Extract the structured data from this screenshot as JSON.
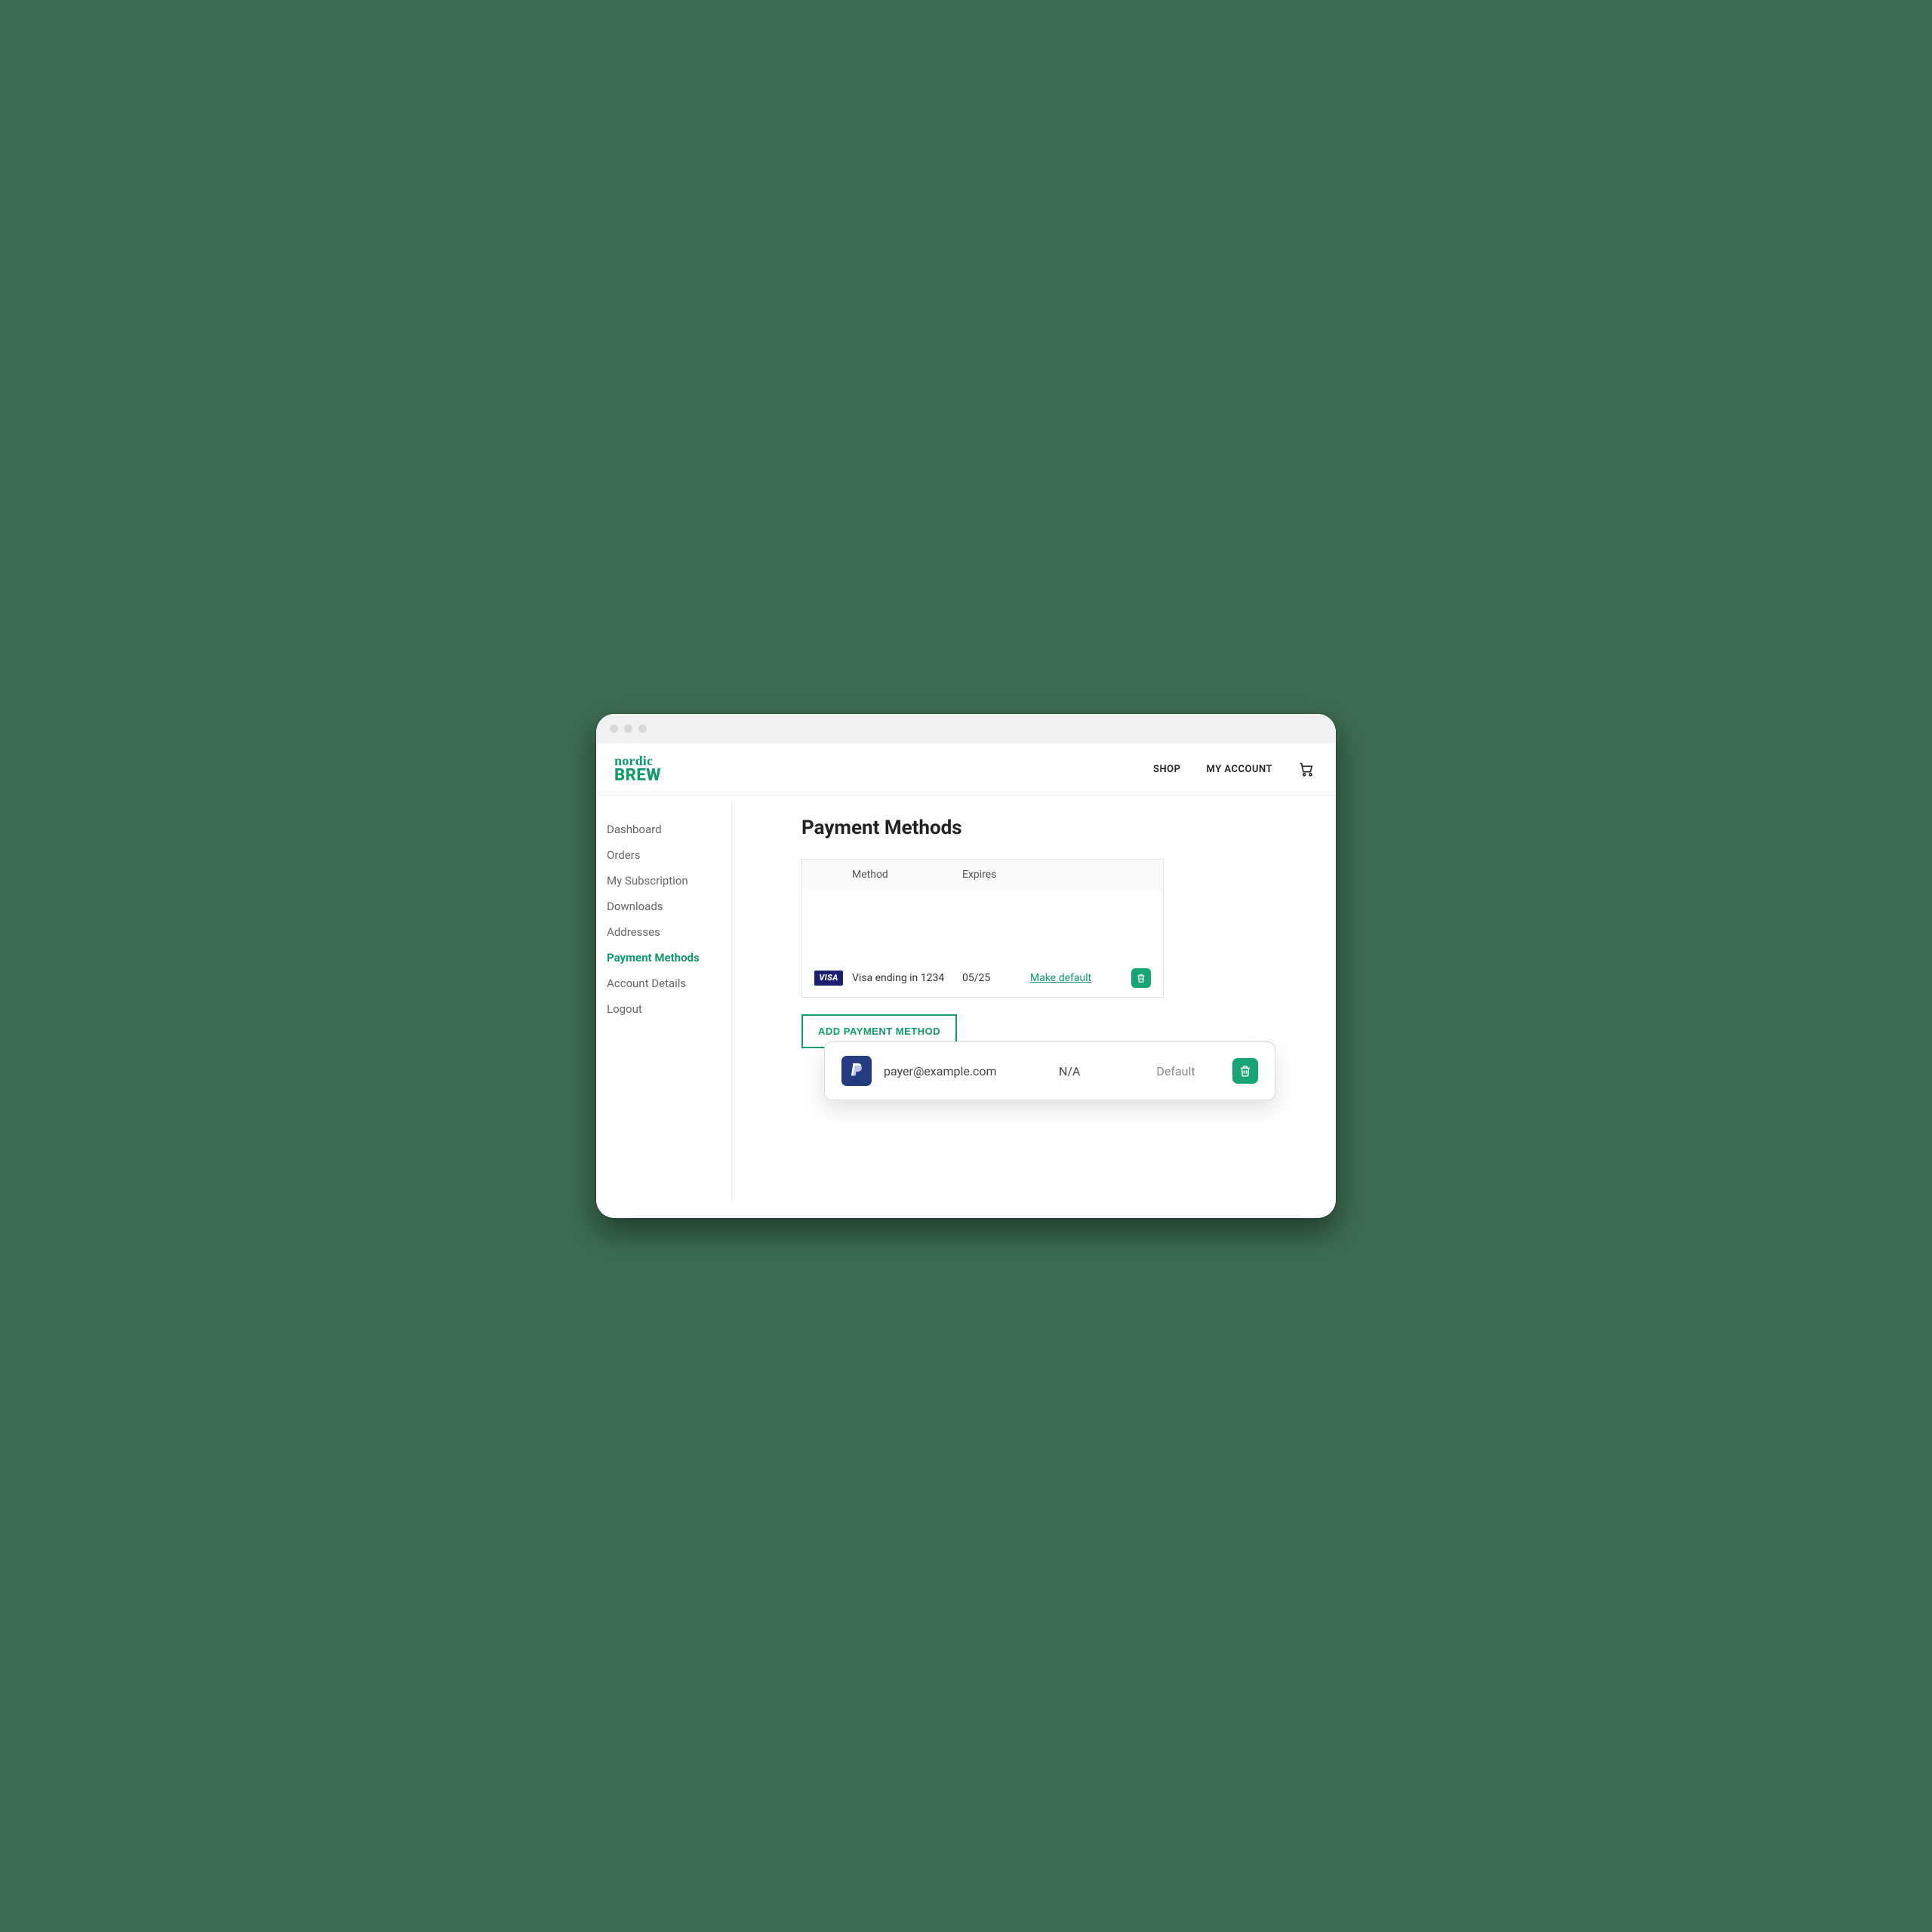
{
  "logo": {
    "line1": "nordic",
    "line2": "BREW"
  },
  "nav": {
    "shop": "SHOP",
    "account": "MY ACCOUNT"
  },
  "sidebar": {
    "items": [
      {
        "label": "Dashboard",
        "active": false
      },
      {
        "label": "Orders",
        "active": false
      },
      {
        "label": "My Subscription",
        "active": false
      },
      {
        "label": "Downloads",
        "active": false
      },
      {
        "label": "Addresses",
        "active": false
      },
      {
        "label": "Payment Methods",
        "active": true
      },
      {
        "label": "Account Details",
        "active": false
      },
      {
        "label": "Logout",
        "active": false
      }
    ]
  },
  "page": {
    "title": "Payment Methods",
    "columns": {
      "method": "Method",
      "expires": "Expires"
    },
    "rows": [
      {
        "icon": "paypal",
        "label": "payer@example.com",
        "expires": "N/A",
        "action": "Default",
        "is_default": true,
        "highlighted": true
      },
      {
        "icon": "visa",
        "icon_label": "VISA",
        "label": "Visa ending in 1234",
        "expires": "05/25",
        "action": "Make default",
        "is_default": false,
        "highlighted": false
      }
    ],
    "add_button": "ADD PAYMENT METHOD"
  },
  "colors": {
    "accent": "#109b68",
    "accent_fill": "#17a673"
  }
}
